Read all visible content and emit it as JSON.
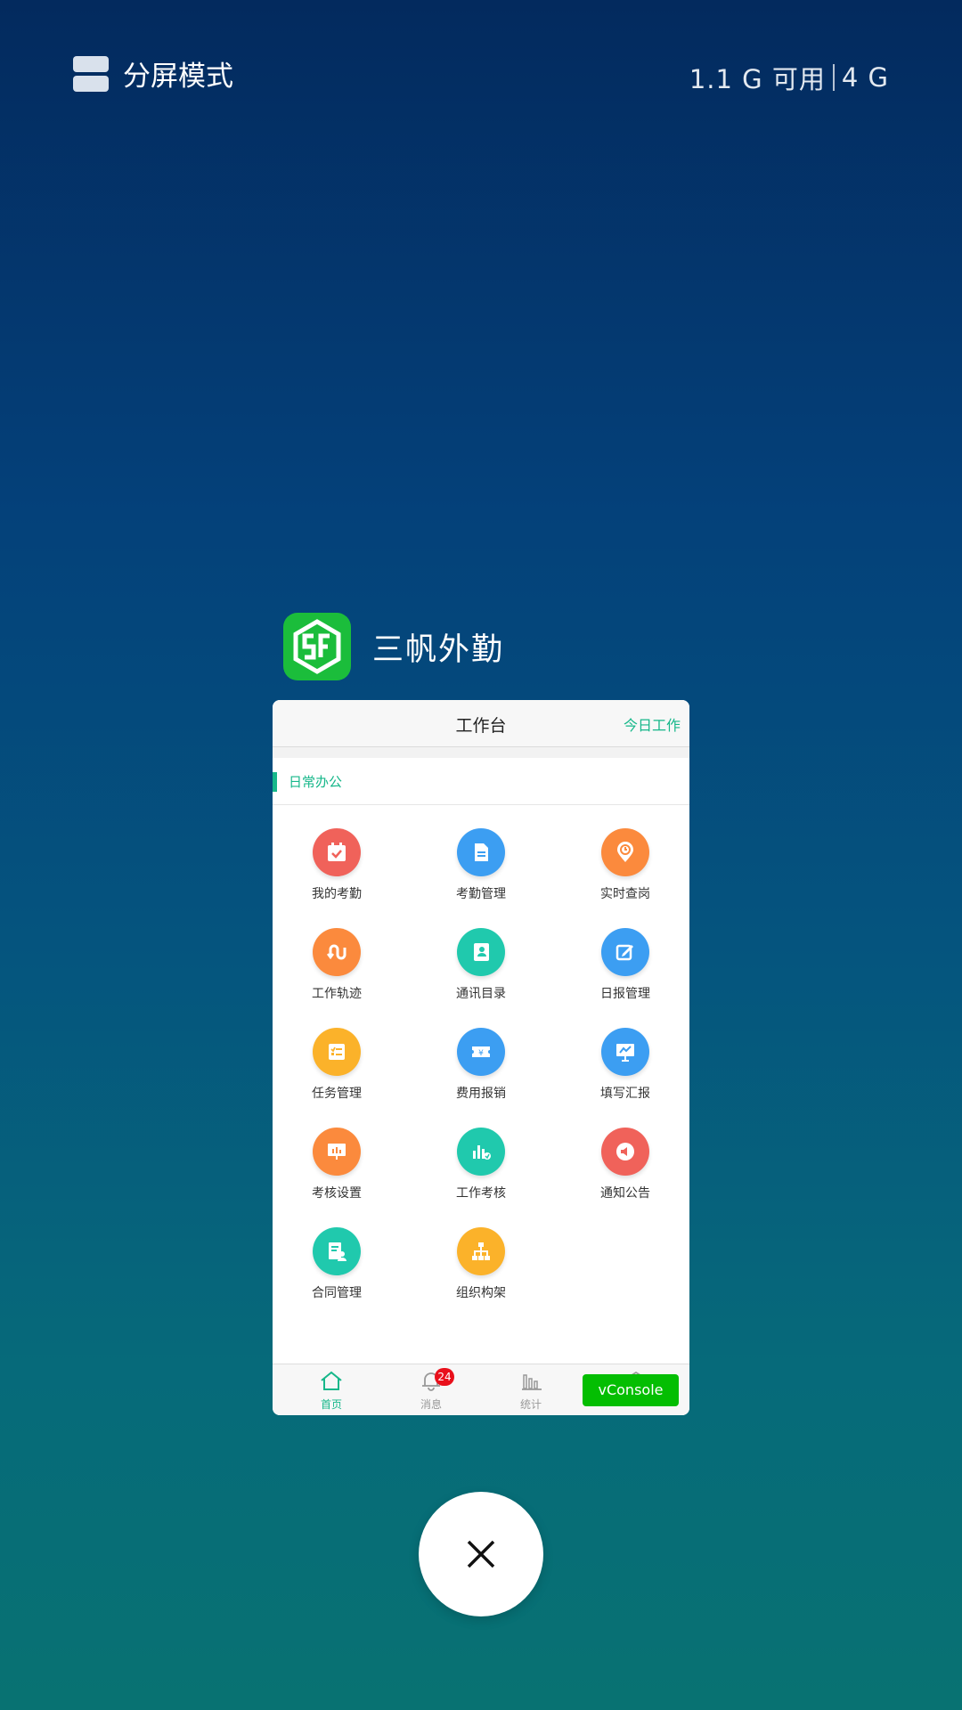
{
  "top_bar": {
    "split_label": "分屏模式",
    "memory": "1.1 G 可用",
    "total": "4 G"
  },
  "app": {
    "name": "三帆外勤"
  },
  "card": {
    "title": "工作台",
    "today": "今日工作",
    "section": "日常办公",
    "tiles": [
      {
        "label": "我的考勤",
        "color": "#f0625a"
      },
      {
        "label": "考勤管理",
        "color": "#3c9ef2"
      },
      {
        "label": "实时查岗",
        "color": "#fb8a3d"
      },
      {
        "label": "工作轨迹",
        "color": "#fb8a3d"
      },
      {
        "label": "通讯目录",
        "color": "#20c9ad"
      },
      {
        "label": "日报管理",
        "color": "#3c9ef2"
      },
      {
        "label": "任务管理",
        "color": "#fbb22a"
      },
      {
        "label": "费用报销",
        "color": "#3c9ef2"
      },
      {
        "label": "填写汇报",
        "color": "#3c9ef2"
      },
      {
        "label": "考核设置",
        "color": "#fb8a3d"
      },
      {
        "label": "工作考核",
        "color": "#20c9ad"
      },
      {
        "label": "通知公告",
        "color": "#f0625a"
      },
      {
        "label": "合同管理",
        "color": "#20c9ad"
      },
      {
        "label": "组织构架",
        "color": "#fbb22a"
      }
    ],
    "tabs": [
      {
        "label": "首页",
        "active": true
      },
      {
        "label": "消息",
        "badge": "24"
      },
      {
        "label": "统计"
      }
    ],
    "vconsole": "vConsole"
  }
}
